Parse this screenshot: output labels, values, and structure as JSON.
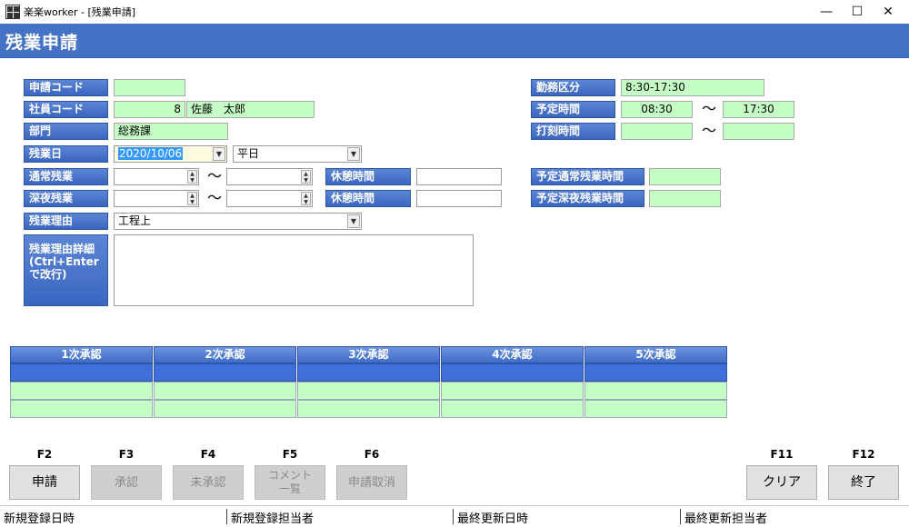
{
  "window": {
    "title": "楽楽worker - [残業申請]",
    "minimize": "—",
    "maximize": "☐",
    "close": "✕"
  },
  "page_title": "残業申請",
  "labels": {
    "request_code": "申請コード",
    "employee_code": "社員コード",
    "department": "部門",
    "overtime_date": "残業日",
    "normal_overtime": "通常残業",
    "night_overtime": "深夜残業",
    "break_time_1": "休憩時間",
    "break_time_2": "休憩時間",
    "overtime_reason": "残業理由",
    "reason_detail": "残業理由詳細(Ctrl+Enterで改行)",
    "work_category": "勤務区分",
    "scheduled_time": "予定時間",
    "clock_time": "打刻時間",
    "sched_normal_ot": "予定通常残業時間",
    "sched_night_ot": "予定深夜残業時間"
  },
  "values": {
    "request_code": "",
    "employee_code": "8",
    "employee_name": "佐藤　太郎",
    "department": "総務課",
    "overtime_date": "2020/10/06",
    "day_type": "平日",
    "normal_start": "",
    "normal_end": "",
    "night_start": "",
    "night_end": "",
    "break_1": "",
    "break_2": "",
    "overtime_reason": "工程上",
    "reason_detail": "",
    "work_category": "8:30-17:30",
    "scheduled_start": "08:30",
    "scheduled_end": "17:30",
    "clock_start": "",
    "clock_end": "",
    "sched_normal_ot": "",
    "sched_night_ot": ""
  },
  "tilde": "〜",
  "approvals": [
    "1次承認",
    "2次承認",
    "3次承認",
    "4次承認",
    "5次承認"
  ],
  "function_keys": [
    {
      "key": "F2",
      "label": "申請",
      "enabled": true
    },
    {
      "key": "F3",
      "label": "承認",
      "enabled": false
    },
    {
      "key": "F4",
      "label": "未承認",
      "enabled": false
    },
    {
      "key": "F5",
      "label": "コメント一覧",
      "enabled": false
    },
    {
      "key": "F6",
      "label": "申請取消",
      "enabled": false
    },
    {
      "key": "F11",
      "label": "クリア",
      "enabled": true
    },
    {
      "key": "F12",
      "label": "終了",
      "enabled": true
    }
  ],
  "status_bar": {
    "created_at": "新規登録日時",
    "created_by": "新規登録担当者",
    "updated_at": "最終更新日時",
    "updated_by": "最終更新担当者"
  },
  "colors": {
    "header_bg": "#4472c4",
    "label_bg": "#4a76cc",
    "readonly_field_bg": "#c6ffc6",
    "selection_bg": "#3399ff"
  }
}
